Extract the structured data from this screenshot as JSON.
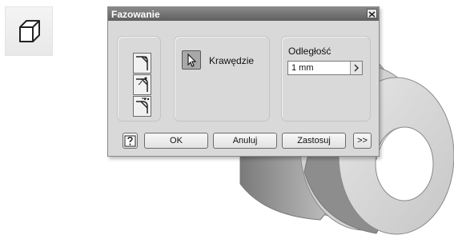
{
  "tool_icon": {
    "icon": "chamfer-tool-icon"
  },
  "dialog": {
    "title": "Fazowanie",
    "close_icon": "close-icon",
    "method_buttons": [
      {
        "icon": "distance-chamfer-icon"
      },
      {
        "icon": "distance-angle-chamfer-icon"
      },
      {
        "icon": "two-distances-chamfer-icon"
      }
    ],
    "edges": {
      "icon": "select-cursor-icon",
      "label": "Krawędzie"
    },
    "distance": {
      "label": "Odległość",
      "value": "1 mm",
      "arrow_icon": "chevron-right-icon"
    },
    "buttons": {
      "help_icon": "help-icon",
      "ok": "OK",
      "cancel": "Anuluj",
      "apply": "Zastosuj",
      "more": ">>"
    }
  },
  "colors": {
    "dialog_bg": "#d9d9d9",
    "titlebar": "#6e6e6e",
    "model": "#bdbdbd"
  }
}
